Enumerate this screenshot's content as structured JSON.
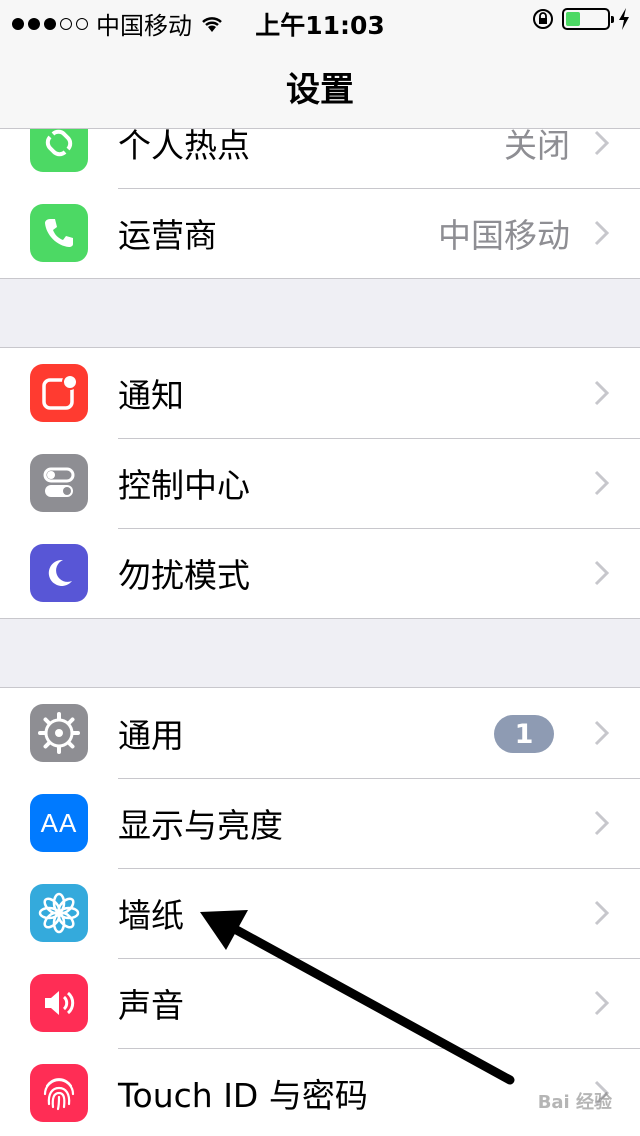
{
  "status_bar": {
    "carrier": "中国移动",
    "time": "上午11:03",
    "battery_color": "#4cd964"
  },
  "nav": {
    "title": "设置"
  },
  "groups": [
    {
      "rows": [
        {
          "label": "个人热点",
          "value": "关闭",
          "icon": "hotspot-icon",
          "icon_color": "#4cd964"
        },
        {
          "label": "运营商",
          "value": "中国移动",
          "icon": "phone-icon",
          "icon_color": "#4cd964"
        }
      ]
    },
    {
      "rows": [
        {
          "label": "通知",
          "icon": "notifications-icon",
          "icon_color": "#ff3b30"
        },
        {
          "label": "控制中心",
          "icon": "control-center-icon",
          "icon_color": "#8e8e93"
        },
        {
          "label": "勿扰模式",
          "icon": "moon-icon",
          "icon_color": "#5856d6"
        }
      ]
    },
    {
      "rows": [
        {
          "label": "通用",
          "badge": "1",
          "icon": "gear-icon",
          "icon_color": "#8e8e93"
        },
        {
          "label": "显示与亮度",
          "icon": "display-icon",
          "icon_color": "#007aff",
          "icon_text": "AA"
        },
        {
          "label": "墙纸",
          "icon": "wallpaper-flower-icon",
          "icon_color": "#34aadc"
        },
        {
          "label": "声音",
          "icon": "speaker-icon",
          "icon_color": "#ff2d55"
        },
        {
          "label": "Touch ID 与密码",
          "icon": "fingerprint-icon",
          "icon_color": "#ff2d55"
        }
      ]
    }
  ],
  "watermark": "Bai 经验"
}
